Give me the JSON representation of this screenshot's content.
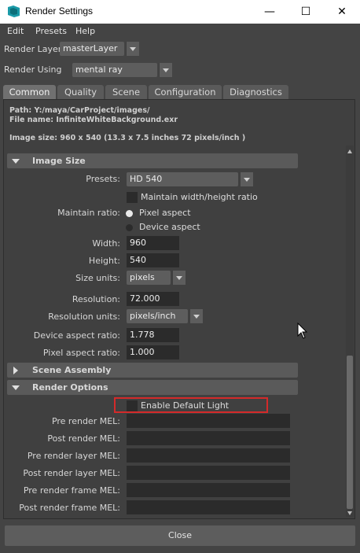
{
  "window": {
    "title": "Render Settings",
    "minimize": "—",
    "maximize": "☐",
    "close": "✕"
  },
  "menu": [
    "Edit",
    "Presets",
    "Help"
  ],
  "render_layer": {
    "label": "Render Layer",
    "value": "masterLayer"
  },
  "render_using": {
    "label": "Render Using",
    "value": "mental ray"
  },
  "tabs": [
    {
      "label": "Common",
      "active": true
    },
    {
      "label": "Quality",
      "active": false
    },
    {
      "label": "Scene",
      "active": false
    },
    {
      "label": "Configuration",
      "active": false
    },
    {
      "label": "Diagnostics",
      "active": false
    }
  ],
  "info": {
    "path": "Path: Y:/maya/CarProject/images/",
    "file_name": "File name:  InfiniteWhiteBackground.exr",
    "image_size": "Image size: 960 x 540 (13.3 x 7.5 inches 72 pixels/inch )"
  },
  "image_size_section": {
    "title": "Image Size",
    "presets_label": "Presets:",
    "presets_value": "HD 540",
    "maintain_wh_label": "Maintain width/height ratio",
    "maintain_ratio_label": "Maintain ratio:",
    "pixel_aspect_label": "Pixel aspect",
    "device_aspect_label": "Device aspect",
    "width_label": "Width:",
    "width_value": "960",
    "height_label": "Height:",
    "height_value": "540",
    "size_units_label": "Size units:",
    "size_units_value": "pixels",
    "resolution_label": "Resolution:",
    "resolution_value": "72.000",
    "resolution_units_label": "Resolution units:",
    "resolution_units_value": "pixels/inch",
    "device_aspect_ratio_label": "Device aspect ratio:",
    "device_aspect_ratio_value": "1.778",
    "pixel_aspect_ratio_label": "Pixel aspect ratio:",
    "pixel_aspect_ratio_value": "1.000"
  },
  "scene_assembly_section": {
    "title": "Scene Assembly"
  },
  "render_options_section": {
    "title": "Render Options",
    "enable_default_light_label": "Enable Default Light",
    "pre_render_mel": "Pre render MEL:",
    "post_render_mel": "Post render MEL:",
    "pre_render_layer_mel": "Pre render layer MEL:",
    "post_render_layer_mel": "Post render layer MEL:",
    "pre_render_frame_mel": "Pre render frame MEL:",
    "post_render_frame_mel": "Post render frame MEL:"
  },
  "close_button": "Close",
  "colors": {
    "highlight": "#d42a2a",
    "background": "#444444",
    "field": "#2b2b2b"
  },
  "icons": [
    "maya-app-icon",
    "minimize-icon",
    "maximize-icon",
    "close-icon",
    "chevron-down-icon",
    "triangle-right-icon",
    "mouse-cursor-icon"
  ]
}
